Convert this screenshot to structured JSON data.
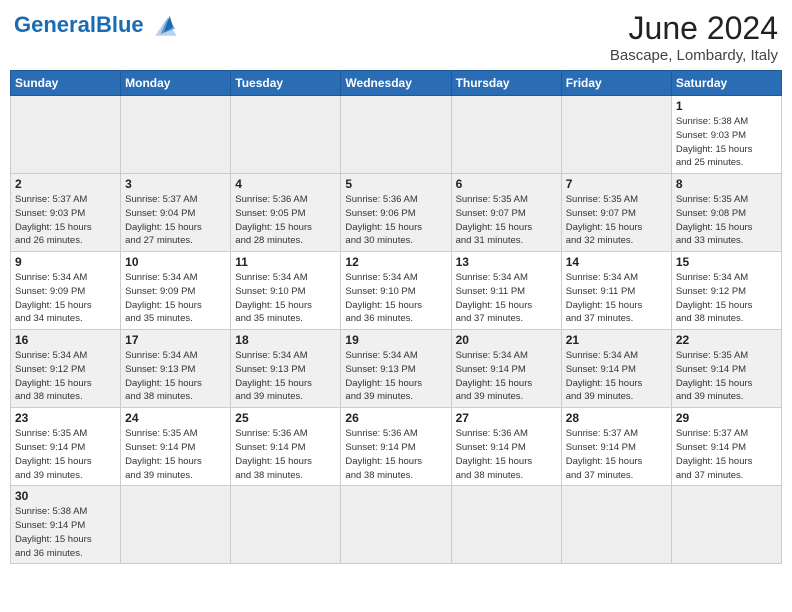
{
  "header": {
    "logo_general": "General",
    "logo_blue": "Blue",
    "month_year": "June 2024",
    "location": "Bascape, Lombardy, Italy"
  },
  "weekdays": [
    "Sunday",
    "Monday",
    "Tuesday",
    "Wednesday",
    "Thursday",
    "Friday",
    "Saturday"
  ],
  "weeks": [
    [
      {
        "day": "",
        "info": ""
      },
      {
        "day": "",
        "info": ""
      },
      {
        "day": "",
        "info": ""
      },
      {
        "day": "",
        "info": ""
      },
      {
        "day": "",
        "info": ""
      },
      {
        "day": "",
        "info": ""
      },
      {
        "day": "1",
        "info": "Sunrise: 5:38 AM\nSunset: 9:03 PM\nDaylight: 15 hours\nand 25 minutes."
      }
    ],
    [
      {
        "day": "2",
        "info": "Sunrise: 5:37 AM\nSunset: 9:03 PM\nDaylight: 15 hours\nand 26 minutes."
      },
      {
        "day": "3",
        "info": "Sunrise: 5:37 AM\nSunset: 9:04 PM\nDaylight: 15 hours\nand 27 minutes."
      },
      {
        "day": "4",
        "info": "Sunrise: 5:36 AM\nSunset: 9:05 PM\nDaylight: 15 hours\nand 28 minutes."
      },
      {
        "day": "5",
        "info": "Sunrise: 5:36 AM\nSunset: 9:06 PM\nDaylight: 15 hours\nand 30 minutes."
      },
      {
        "day": "6",
        "info": "Sunrise: 5:35 AM\nSunset: 9:07 PM\nDaylight: 15 hours\nand 31 minutes."
      },
      {
        "day": "7",
        "info": "Sunrise: 5:35 AM\nSunset: 9:07 PM\nDaylight: 15 hours\nand 32 minutes."
      },
      {
        "day": "8",
        "info": "Sunrise: 5:35 AM\nSunset: 9:08 PM\nDaylight: 15 hours\nand 33 minutes."
      }
    ],
    [
      {
        "day": "9",
        "info": "Sunrise: 5:34 AM\nSunset: 9:09 PM\nDaylight: 15 hours\nand 34 minutes."
      },
      {
        "day": "10",
        "info": "Sunrise: 5:34 AM\nSunset: 9:09 PM\nDaylight: 15 hours\nand 35 minutes."
      },
      {
        "day": "11",
        "info": "Sunrise: 5:34 AM\nSunset: 9:10 PM\nDaylight: 15 hours\nand 35 minutes."
      },
      {
        "day": "12",
        "info": "Sunrise: 5:34 AM\nSunset: 9:10 PM\nDaylight: 15 hours\nand 36 minutes."
      },
      {
        "day": "13",
        "info": "Sunrise: 5:34 AM\nSunset: 9:11 PM\nDaylight: 15 hours\nand 37 minutes."
      },
      {
        "day": "14",
        "info": "Sunrise: 5:34 AM\nSunset: 9:11 PM\nDaylight: 15 hours\nand 37 minutes."
      },
      {
        "day": "15",
        "info": "Sunrise: 5:34 AM\nSunset: 9:12 PM\nDaylight: 15 hours\nand 38 minutes."
      }
    ],
    [
      {
        "day": "16",
        "info": "Sunrise: 5:34 AM\nSunset: 9:12 PM\nDaylight: 15 hours\nand 38 minutes."
      },
      {
        "day": "17",
        "info": "Sunrise: 5:34 AM\nSunset: 9:13 PM\nDaylight: 15 hours\nand 38 minutes."
      },
      {
        "day": "18",
        "info": "Sunrise: 5:34 AM\nSunset: 9:13 PM\nDaylight: 15 hours\nand 39 minutes."
      },
      {
        "day": "19",
        "info": "Sunrise: 5:34 AM\nSunset: 9:13 PM\nDaylight: 15 hours\nand 39 minutes."
      },
      {
        "day": "20",
        "info": "Sunrise: 5:34 AM\nSunset: 9:14 PM\nDaylight: 15 hours\nand 39 minutes."
      },
      {
        "day": "21",
        "info": "Sunrise: 5:34 AM\nSunset: 9:14 PM\nDaylight: 15 hours\nand 39 minutes."
      },
      {
        "day": "22",
        "info": "Sunrise: 5:35 AM\nSunset: 9:14 PM\nDaylight: 15 hours\nand 39 minutes."
      }
    ],
    [
      {
        "day": "23",
        "info": "Sunrise: 5:35 AM\nSunset: 9:14 PM\nDaylight: 15 hours\nand 39 minutes."
      },
      {
        "day": "24",
        "info": "Sunrise: 5:35 AM\nSunset: 9:14 PM\nDaylight: 15 hours\nand 39 minutes."
      },
      {
        "day": "25",
        "info": "Sunrise: 5:36 AM\nSunset: 9:14 PM\nDaylight: 15 hours\nand 38 minutes."
      },
      {
        "day": "26",
        "info": "Sunrise: 5:36 AM\nSunset: 9:14 PM\nDaylight: 15 hours\nand 38 minutes."
      },
      {
        "day": "27",
        "info": "Sunrise: 5:36 AM\nSunset: 9:14 PM\nDaylight: 15 hours\nand 38 minutes."
      },
      {
        "day": "28",
        "info": "Sunrise: 5:37 AM\nSunset: 9:14 PM\nDaylight: 15 hours\nand 37 minutes."
      },
      {
        "day": "29",
        "info": "Sunrise: 5:37 AM\nSunset: 9:14 PM\nDaylight: 15 hours\nand 37 minutes."
      }
    ],
    [
      {
        "day": "30",
        "info": "Sunrise: 5:38 AM\nSunset: 9:14 PM\nDaylight: 15 hours\nand 36 minutes."
      },
      {
        "day": "",
        "info": ""
      },
      {
        "day": "",
        "info": ""
      },
      {
        "day": "",
        "info": ""
      },
      {
        "day": "",
        "info": ""
      },
      {
        "day": "",
        "info": ""
      },
      {
        "day": "",
        "info": ""
      }
    ]
  ]
}
